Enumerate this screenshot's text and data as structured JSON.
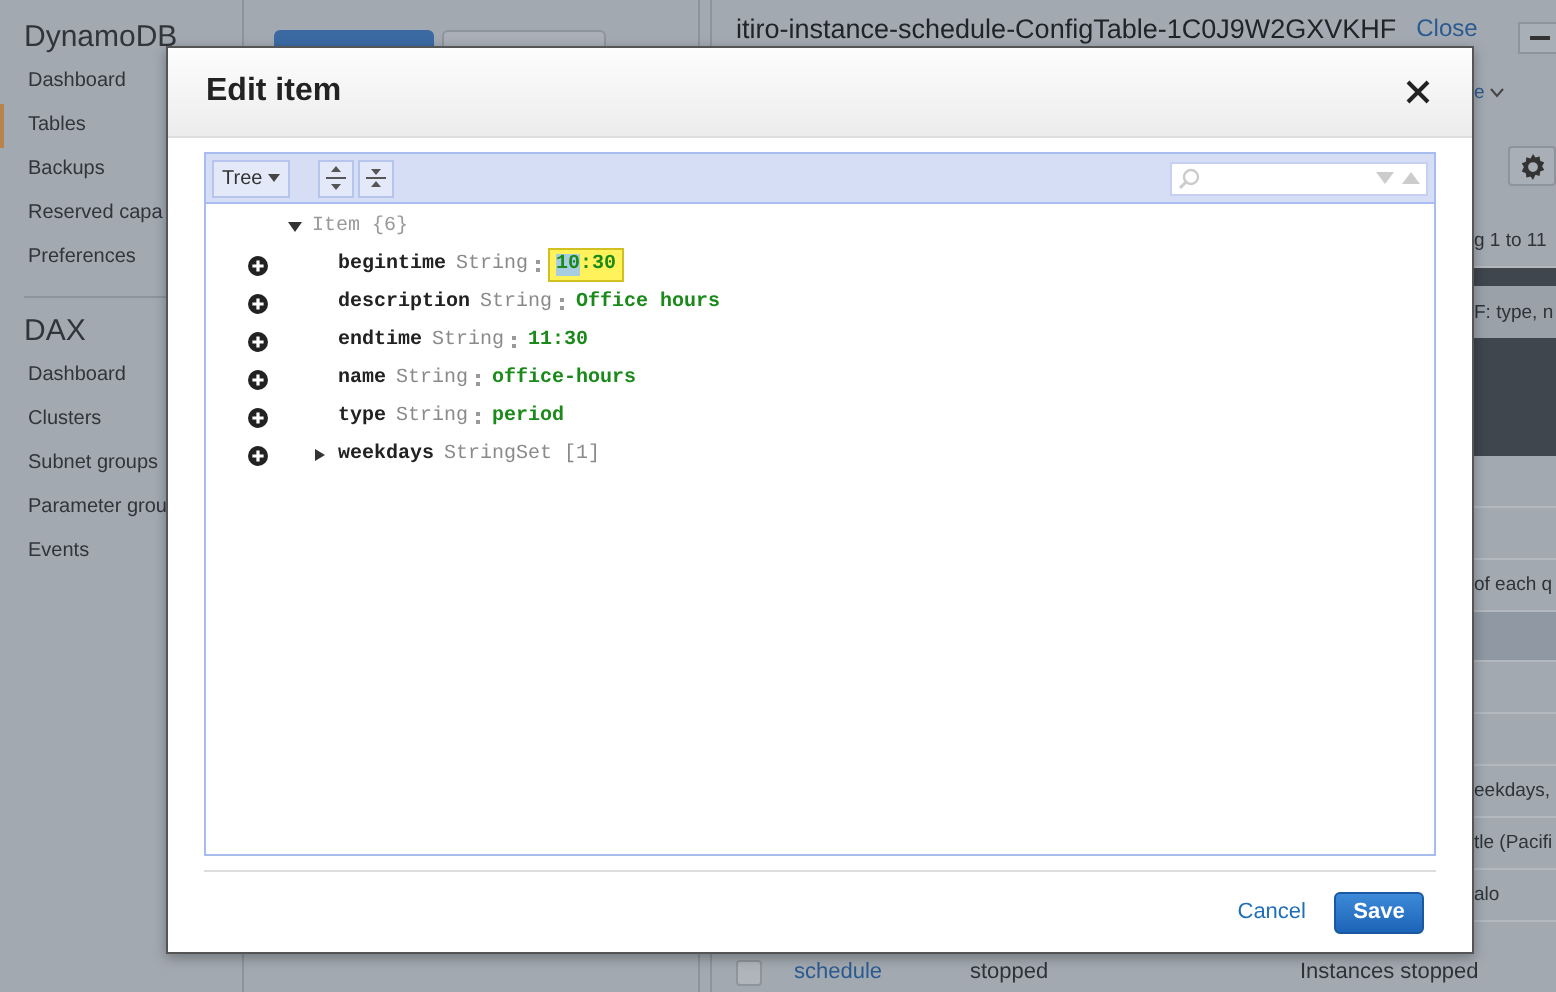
{
  "sidebar": {
    "sections": [
      {
        "title": "DynamoDB",
        "items": [
          {
            "label": "Dashboard",
            "selected": false
          },
          {
            "label": "Tables",
            "selected": true
          },
          {
            "label": "Backups",
            "selected": false
          },
          {
            "label": "Reserved capa",
            "selected": false
          },
          {
            "label": "Preferences",
            "selected": false
          }
        ]
      },
      {
        "title": "DAX",
        "items": [
          {
            "label": "Dashboard",
            "selected": false
          },
          {
            "label": "Clusters",
            "selected": false
          },
          {
            "label": "Subnet groups",
            "selected": false
          },
          {
            "label": "Parameter grou",
            "selected": false
          },
          {
            "label": "Events",
            "selected": false
          }
        ]
      }
    ]
  },
  "table_header": {
    "title": "itiro-instance-schedule-ConfigTable-1C0J9W2GXVKHF",
    "close_link": "Close"
  },
  "strip_rows": [
    {
      "kind": "dropdown",
      "text": "e"
    },
    {
      "kind": "gear"
    },
    {
      "kind": "text",
      "text": "g 1 to 11"
    },
    {
      "kind": "dark"
    },
    {
      "kind": "column_header",
      "text": "F: type, n"
    },
    {
      "kind": "dark_tall"
    },
    {
      "kind": "plain"
    },
    {
      "kind": "plain"
    },
    {
      "kind": "text",
      "text": "of each q"
    },
    {
      "kind": "highlight"
    },
    {
      "kind": "plain"
    },
    {
      "kind": "plain"
    },
    {
      "kind": "text",
      "text": "eekdays,"
    },
    {
      "kind": "text",
      "text": "tle (Pacifi"
    },
    {
      "kind": "text",
      "text": "alo"
    }
  ],
  "bottom_row": {
    "checked": false,
    "name": "schedule",
    "state": "stopped",
    "message": "Instances stopped"
  },
  "dialog": {
    "title": "Edit item",
    "mode": "Tree",
    "root": {
      "label": "Item",
      "meta": "{6}",
      "expanded": true,
      "children": [
        {
          "key": "begintime",
          "type": "String",
          "kind": "input",
          "value_parts": [
            {
              "text": "10",
              "selected": true
            },
            {
              "text": ":30",
              "selected": false
            }
          ]
        },
        {
          "key": "description",
          "type": "String",
          "kind": "value",
          "value_parts": [
            {
              "text": "Office hours",
              "selected": false
            }
          ]
        },
        {
          "key": "endtime",
          "type": "String",
          "kind": "value",
          "value_parts": [
            {
              "text": "11:30",
              "selected": false
            }
          ]
        },
        {
          "key": "name",
          "type": "String",
          "kind": "value",
          "value_parts": [
            {
              "text": "office-hours",
              "selected": false
            }
          ]
        },
        {
          "key": "type",
          "type": "String",
          "kind": "value",
          "value_parts": [
            {
              "text": "period",
              "selected": false
            }
          ]
        },
        {
          "key": "weekdays",
          "type": "StringSet",
          "meta": "[1]",
          "kind": "set",
          "expanded": false
        }
      ]
    },
    "cancel": "Cancel",
    "save": "Save"
  }
}
